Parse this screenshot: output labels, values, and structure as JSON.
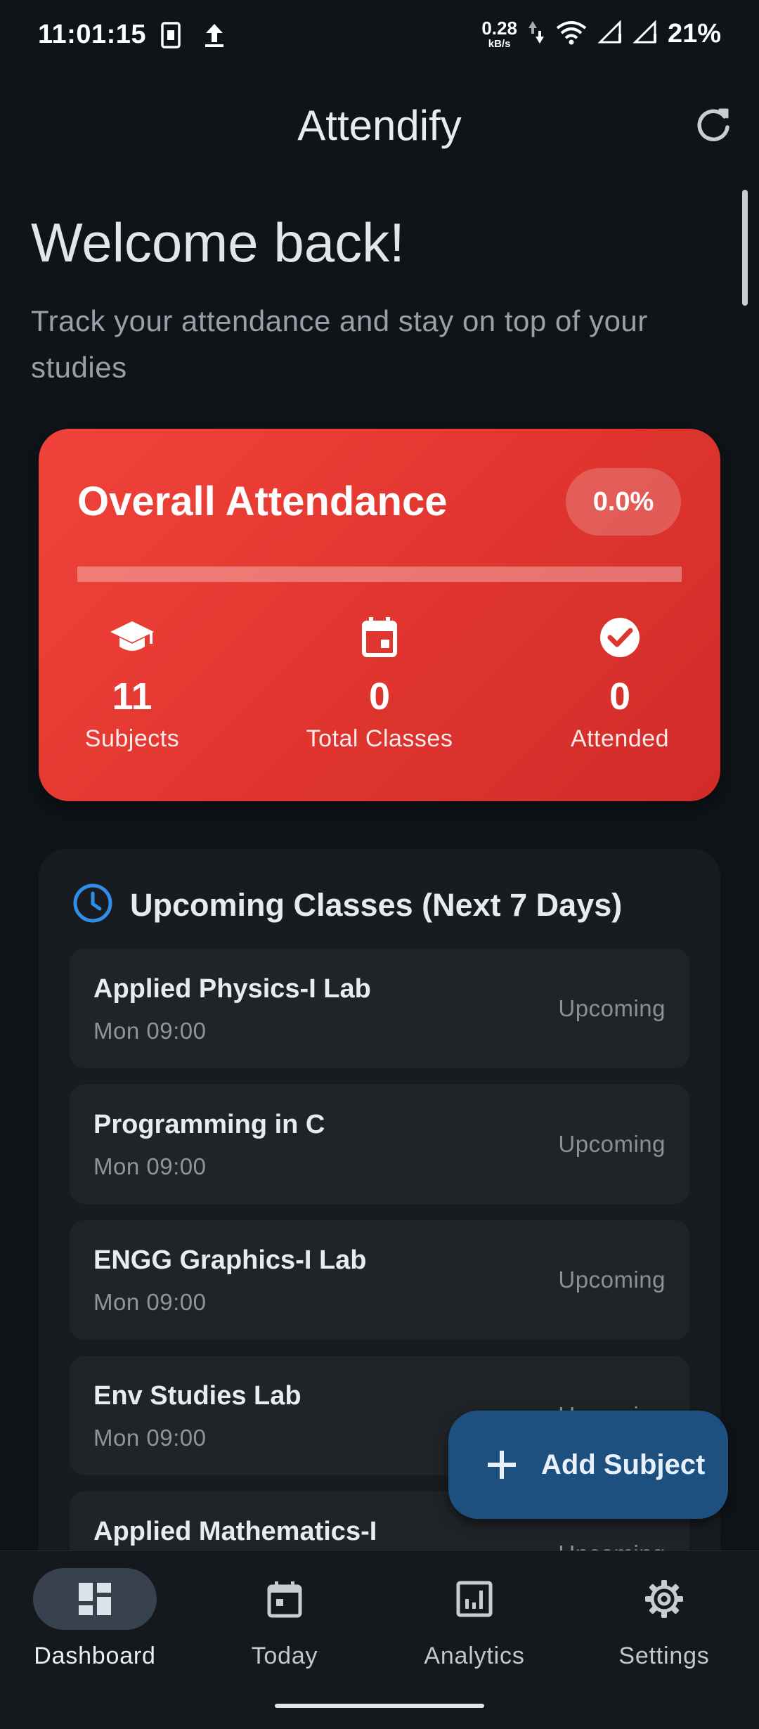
{
  "status_bar": {
    "time": "11:01:15",
    "net_speed_value": "0.28",
    "net_speed_unit": "kB/s",
    "battery": "21%",
    "icons": [
      "sim-icon",
      "upload-icon",
      "speed-arrows-icon",
      "wifi-icon",
      "signal-icon",
      "signal-icon"
    ]
  },
  "app_bar": {
    "title": "Attendify",
    "refresh_icon": "refresh-icon"
  },
  "welcome": {
    "title": "Welcome back!",
    "subtitle": "Track your attendance and stay on top of your studies"
  },
  "overall": {
    "title": "Overall Attendance",
    "percentage": "0.0%",
    "progress_fraction": 0.0,
    "stats": [
      {
        "icon": "graduation-cap-icon",
        "value": "11",
        "label": "Subjects"
      },
      {
        "icon": "calendar-icon",
        "value": "0",
        "label": "Total Classes"
      },
      {
        "icon": "check-circle-icon",
        "value": "0",
        "label": "Attended"
      }
    ],
    "color": "#e53935"
  },
  "upcoming": {
    "icon": "clock-icon",
    "title": "Upcoming Classes (Next 7 Days)",
    "items": [
      {
        "name": "Applied Physics-I Lab",
        "time": "Mon 09:00",
        "status": "Upcoming"
      },
      {
        "name": "Programming in C",
        "time": "Mon 09:00",
        "status": "Upcoming"
      },
      {
        "name": "ENGG Graphics-I Lab",
        "time": "Mon 09:00",
        "status": "Upcoming"
      },
      {
        "name": "Env Studies Lab",
        "time": "Mon 09:00",
        "status": "Upcoming"
      },
      {
        "name": "Applied Mathematics-I",
        "time": "",
        "status": "Upcoming"
      }
    ]
  },
  "fab": {
    "icon": "plus-icon",
    "label": "Add Subject",
    "color": "#1d4f7f"
  },
  "bottom_nav": {
    "items": [
      {
        "icon": "dashboard-icon",
        "label": "Dashboard",
        "active": true
      },
      {
        "icon": "calendar-icon",
        "label": "Today",
        "active": false
      },
      {
        "icon": "analytics-icon",
        "label": "Analytics",
        "active": false
      },
      {
        "icon": "settings-gear-icon",
        "label": "Settings",
        "active": false
      }
    ]
  }
}
